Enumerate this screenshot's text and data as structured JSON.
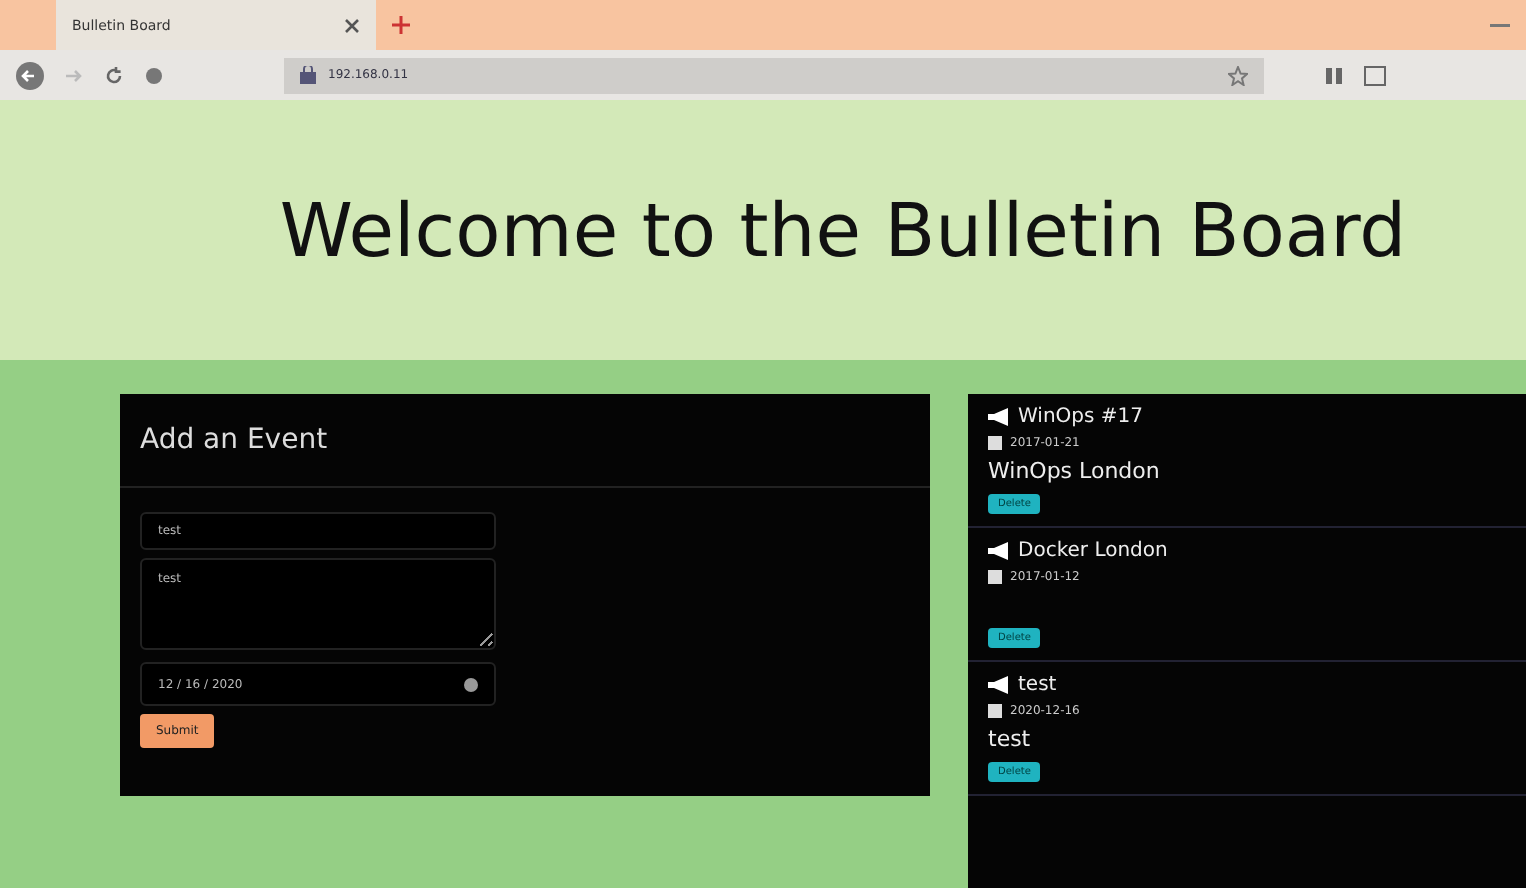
{
  "browser": {
    "tab_title": "Bulletin Board",
    "address": "192.168.0.11"
  },
  "header": {
    "title": "Welcome to the Bulletin Board"
  },
  "form": {
    "title": "Add an Event",
    "name_value": "test",
    "description_value": "test",
    "date_value": "12 / 16 / 2020",
    "submit": "Submit"
  },
  "events": [
    {
      "title": "WinOps #17",
      "date": "2017-01-21",
      "description": "WinOps London",
      "delete": "Delete"
    },
    {
      "title": "Docker London",
      "date": "2017-01-12",
      "delete": "Delete"
    },
    {
      "title": "test",
      "date": "2020-12-16",
      "description": "test",
      "delete": "Delete"
    }
  ]
}
